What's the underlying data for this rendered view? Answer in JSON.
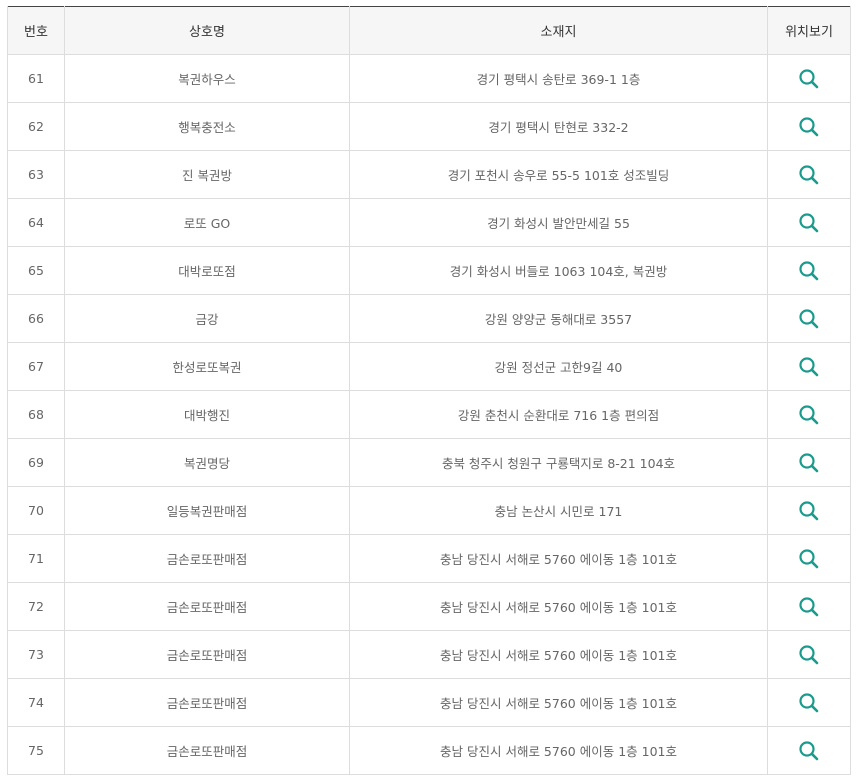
{
  "table": {
    "headers": {
      "number": "번호",
      "name": "상호명",
      "address": "소재지",
      "location": "위치보기"
    },
    "accent_color": "#1a9a8c",
    "location_icon": "search-icon",
    "rows": [
      {
        "number": "61",
        "name": "복권하우스",
        "address": "경기 평택시 송탄로 369-1 1층"
      },
      {
        "number": "62",
        "name": "행복충전소",
        "address": "경기 평택시 탄현로 332-2"
      },
      {
        "number": "63",
        "name": "진 복권방",
        "address": "경기 포천시 송우로 55-5 101호 성조빌딩"
      },
      {
        "number": "64",
        "name": "로또 GO",
        "address": "경기 화성시 발안만세길 55"
      },
      {
        "number": "65",
        "name": "대박로또점",
        "address": "경기 화성시 버들로 1063 104호, 복권방"
      },
      {
        "number": "66",
        "name": "금강",
        "address": "강원 양양군 동해대로 3557"
      },
      {
        "number": "67",
        "name": "한성로또복권",
        "address": "강원 정선군 고한9길 40"
      },
      {
        "number": "68",
        "name": "대박행진",
        "address": "강원 춘천시 순환대로 716 1층 편의점"
      },
      {
        "number": "69",
        "name": "복권명당",
        "address": "충북 청주시 청원구 구룡택지로 8-21 104호"
      },
      {
        "number": "70",
        "name": "일등복권판매점",
        "address": "충남 논산시 시민로 171"
      },
      {
        "number": "71",
        "name": "금손로또판매점",
        "address": "충남 당진시 서해로 5760 에이동 1층 101호"
      },
      {
        "number": "72",
        "name": "금손로또판매점",
        "address": "충남 당진시 서해로 5760 에이동 1층 101호"
      },
      {
        "number": "73",
        "name": "금손로또판매점",
        "address": "충남 당진시 서해로 5760 에이동 1층 101호"
      },
      {
        "number": "74",
        "name": "금손로또판매점",
        "address": "충남 당진시 서해로 5760 에이동 1층 101호"
      },
      {
        "number": "75",
        "name": "금손로또판매점",
        "address": "충남 당진시 서해로 5760 에이동 1층 101호"
      }
    ]
  }
}
